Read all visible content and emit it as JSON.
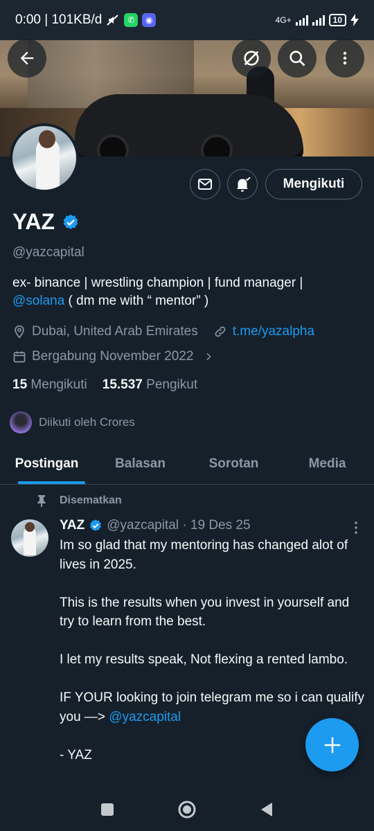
{
  "status_bar": {
    "time_speed": "0:00 | 101KB/d",
    "network": "4G+",
    "battery": "10"
  },
  "header": {
    "icons": [
      "back-arrow-icon",
      "grok-icon",
      "search-icon",
      "more-vertical-icon"
    ]
  },
  "profile": {
    "name": "YAZ",
    "handle": "@yazcapital",
    "follow_label": "Mengikuti",
    "bio_text": "ex- binance | wrestling champion | fund manager |",
    "bio_mention": "@solana",
    "bio_text2": " ( dm me with “ mentor” )",
    "location": "Dubai, United Arab Emirates",
    "website": "t.me/yazalpha",
    "joined": "Bergabung November 2022",
    "following_count": "15",
    "following_label": "Mengikuti",
    "followers_count": "15.537",
    "followers_label": "Pengikut",
    "followed_by": "Diikuti oleh Crores"
  },
  "tabs": [
    {
      "label": "Postingan",
      "active": true
    },
    {
      "label": "Balasan",
      "active": false
    },
    {
      "label": "Sorotan",
      "active": false
    },
    {
      "label": "Media",
      "active": false
    }
  ],
  "post": {
    "pinned_label": "Disematkan",
    "author": "YAZ",
    "handle_date": "@yazcapital · 19 Des 25",
    "para1": "Im so glad that my mentoring has changed alot of lives in 2025.",
    "para2": "This is the results when you invest in yourself and try to learn from the best.",
    "para3": "I let my results speak, Not flexing a rented lambo.",
    "para4_text": "IF YOUR looking to join telegram me so i can qualify you —> ",
    "para4_mention": "@yazcapital",
    "para5": "- YAZ"
  },
  "colors": {
    "background": "#15202b",
    "accent": "#1d9bf0",
    "muted": "#8b98a5"
  }
}
